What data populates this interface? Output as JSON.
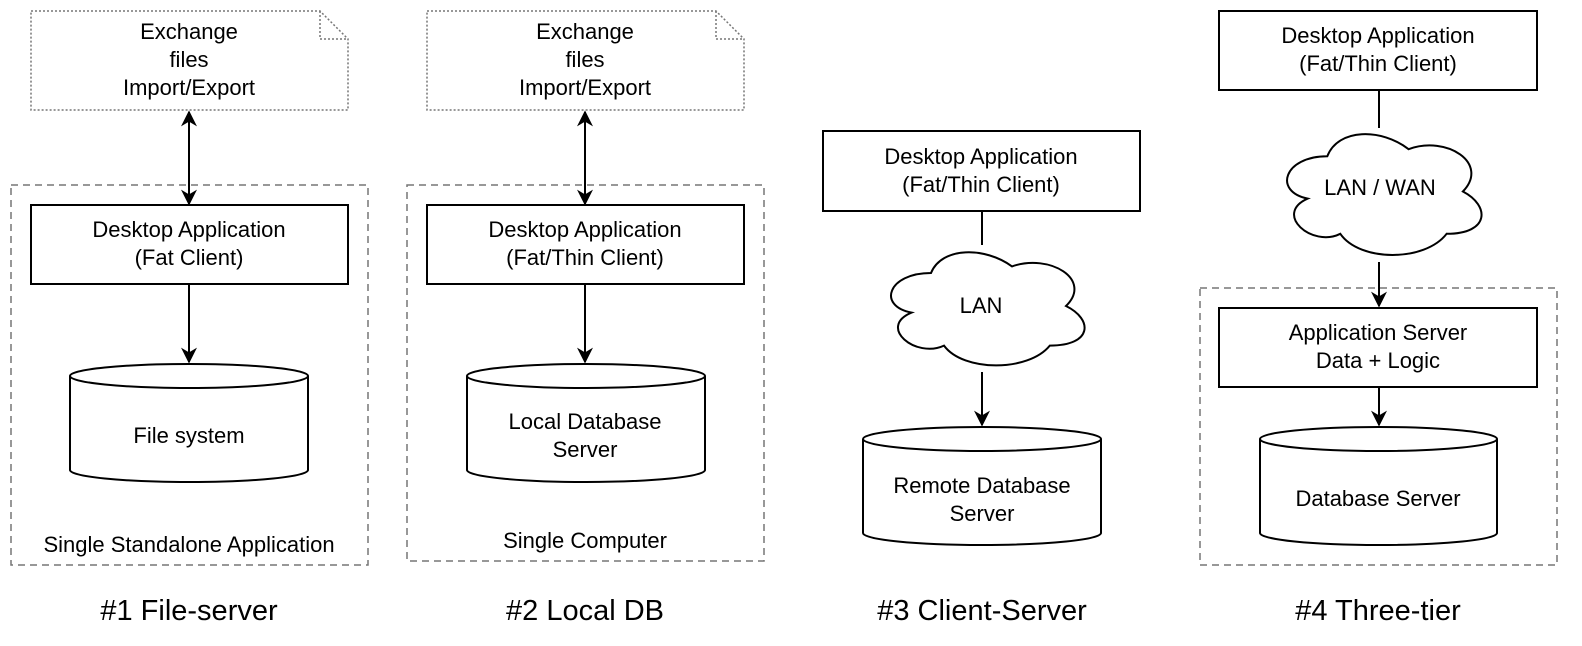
{
  "columns": [
    {
      "title": "#1 File-server",
      "note": [
        "Exchange",
        "files",
        "Import/Export"
      ],
      "app": [
        "Desktop Application",
        "(Fat Client)"
      ],
      "storage": [
        "File system"
      ],
      "group_label": "Single Standalone Application"
    },
    {
      "title": "#2 Local DB",
      "note": [
        "Exchange",
        "files",
        "Import/Export"
      ],
      "app": [
        "Desktop Application",
        "(Fat/Thin Client)"
      ],
      "storage": [
        "Local Database",
        "Server"
      ],
      "group_label": "Single Computer"
    },
    {
      "title": "#3 Client-Server",
      "app": [
        "Desktop Application",
        "(Fat/Thin Client)"
      ],
      "network": "LAN",
      "storage": [
        "Remote Database",
        "Server"
      ]
    },
    {
      "title": "#4 Three-tier",
      "app": [
        "Desktop Application",
        "(Fat/Thin Client)"
      ],
      "network": "LAN / WAN",
      "server": [
        "Application Server",
        "Data + Logic"
      ],
      "storage": [
        "Database Server"
      ]
    }
  ]
}
